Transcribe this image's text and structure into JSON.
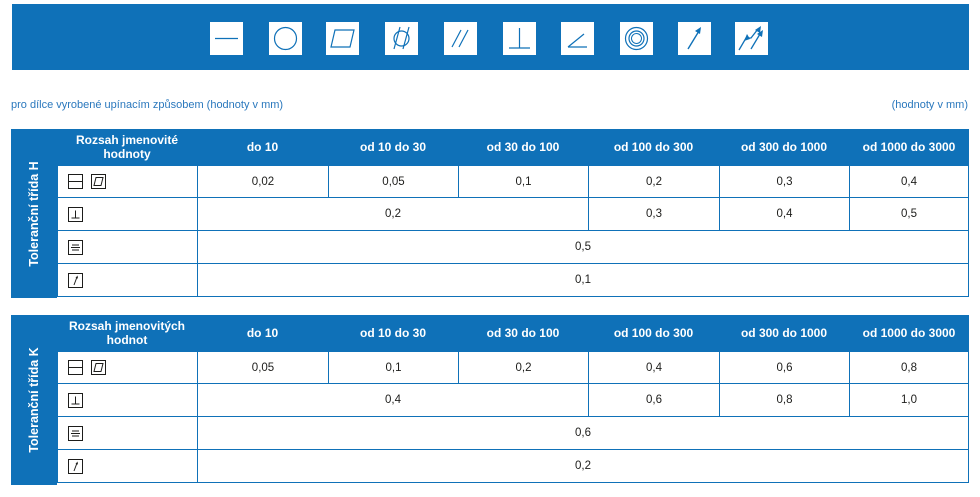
{
  "symbols": [
    "straightness-icon",
    "circularity-icon",
    "flatness-icon",
    "cylindricity-icon",
    "parallelism-icon",
    "perpendicularity-icon",
    "angularity-icon",
    "concentricity-icon",
    "circular-runout-icon",
    "total-runout-icon"
  ],
  "caption_left": "pro dílce vyrobené upínacím způsobem (hodnoty v mm)",
  "caption_right": "(hodnoty v mm)",
  "colors": {
    "brand": "#0f71b8",
    "caption": "#2a78bd"
  },
  "table_h": {
    "side_label": "Toleranční třída H",
    "range_label": "Rozsah jmenovité hodnoty",
    "columns": [
      "do 10",
      "od 10 do 30",
      "od 30 do 100",
      "od 100 do 300",
      "od 300 do 1000",
      "od 1000 do 3000"
    ],
    "row_flat": [
      "0,02",
      "0,05",
      "0,1",
      "0,2",
      "0,3",
      "0,4"
    ],
    "row_perp": [
      "0,2",
      "0,3",
      "0,4",
      "0,5"
    ],
    "row_sym": "0,5",
    "row_runout": "0,1"
  },
  "table_k": {
    "side_label": "Toleranční třída K",
    "range_label": "Rozsah jmenovitých hodnot",
    "columns": [
      "do 10",
      "od 10 do 30",
      "od 30 do 100",
      "od 100 do 300",
      "od 300 do 1000",
      "od 1000 do 3000"
    ],
    "row_flat": [
      "0,05",
      "0,1",
      "0,2",
      "0,4",
      "0,6",
      "0,8"
    ],
    "row_perp": [
      "0,4",
      "0,6",
      "0,8",
      "1,0"
    ],
    "row_sym": "0,6",
    "row_runout": "0,2"
  }
}
